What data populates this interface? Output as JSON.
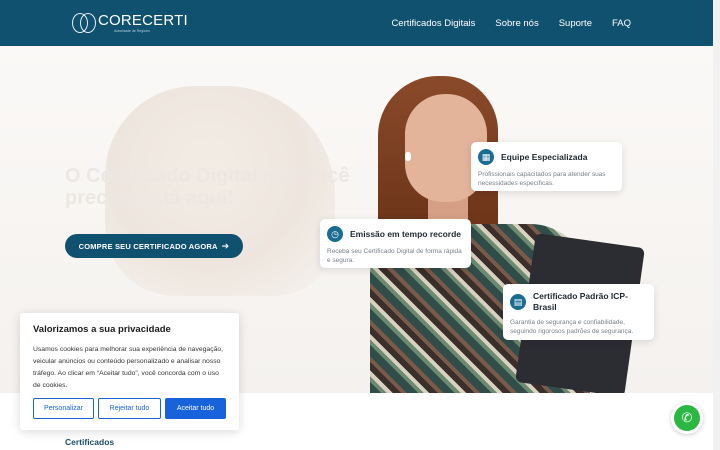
{
  "header": {
    "logo_name": "CORECERTI",
    "logo_tagline": "Autoridade de Registro",
    "nav": [
      {
        "label": "Certificados Digitais"
      },
      {
        "label": "Sobre nós"
      },
      {
        "label": "Suporte"
      },
      {
        "label": "FAQ"
      }
    ]
  },
  "hero": {
    "headline": "O Certificado Digital que você precisa está aqui!",
    "cta_label": "COMPRE SEU CERTIFICADO AGORA"
  },
  "features": {
    "equipe": {
      "title": "Equipe Especializada",
      "description": "Profissionais capacitados para atender suas necessidades específicas.",
      "icon": "building-icon"
    },
    "emissao": {
      "title": "Emissão em tempo recorde",
      "description": "Receba seu Certificado Digital de forma rápida e segura.",
      "icon": "clock-icon"
    },
    "padrao": {
      "title": "Certificado Padrão ICP-Brasil",
      "description": "Garantia de segurança e confiabilidade, seguindo rigorosos padrões de segurança.",
      "icon": "certificate-icon"
    }
  },
  "cookie_banner": {
    "title": "Valorizamos a sua privacidade",
    "text": "Usamos cookies para melhorar sua experiência de navegação, veicular anúncios ou conteúdo personalizado e analisar nosso tráfego. Ao clicar em “Aceitar tudo”, você concorda com o uso de cookies.",
    "customize_label": "Personalizar",
    "reject_label": "Rejeitar tudo",
    "accept_label": "Aceitar tudo"
  },
  "section": {
    "tab_label": "Certificados"
  },
  "colors": {
    "primary": "#115170",
    "accent_blue": "#1863dc",
    "whatsapp": "#2bb741"
  }
}
